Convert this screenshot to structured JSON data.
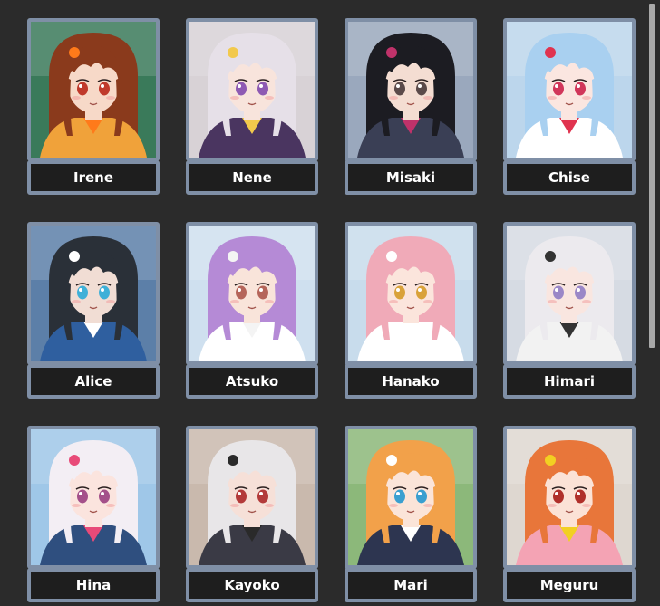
{
  "characters": [
    {
      "name": "Irene",
      "icon": "character-portrait-icon",
      "bg": "#3a7a5a",
      "hair": "#8a3a1c",
      "skin": "#f7d9c8",
      "eyes": "#c0392b",
      "outfit": "#f0a23a",
      "accent": "#ff7a1a"
    },
    {
      "name": "Nene",
      "icon": "character-portrait-icon",
      "bg": "#d8d2d6",
      "hair": "#e6e0e8",
      "skin": "#f8e4dc",
      "eyes": "#8e5ab3",
      "outfit": "#4a3560",
      "accent": "#f2c94c"
    },
    {
      "name": "Misaki",
      "icon": "character-portrait-icon",
      "bg": "#9aa8bd",
      "hair": "#1c1c22",
      "skin": "#f4ddd2",
      "eyes": "#5b4a4a",
      "outfit": "#3a3f55",
      "accent": "#c0326a"
    },
    {
      "name": "Chise",
      "icon": "character-portrait-icon",
      "bg": "#bcd6ec",
      "hair": "#a9d0f0",
      "skin": "#fbe6e0",
      "eyes": "#d1365a",
      "outfit": "#ffffff",
      "accent": "#e0334f"
    },
    {
      "name": "Alice",
      "icon": "character-portrait-icon",
      "bg": "#5c7fa8",
      "hair": "#2a3038",
      "skin": "#f1ddd4",
      "eyes": "#3fb0d8",
      "outfit": "#2f5f9f",
      "accent": "#ffffff"
    },
    {
      "name": "Atsuko",
      "icon": "character-portrait-icon",
      "bg": "#cfe0ef",
      "hair": "#b58ad6",
      "skin": "#f9e4da",
      "eyes": "#b5655a",
      "outfit": "#ffffff",
      "accent": "#f4f4f4"
    },
    {
      "name": "Hanako",
      "icon": "character-portrait-icon",
      "bg": "#c8dcec",
      "hair": "#f0aab8",
      "skin": "#fbe5dc",
      "eyes": "#d9a23a",
      "outfit": "#ffffff",
      "accent": "#ffffff"
    },
    {
      "name": "Himari",
      "icon": "character-portrait-icon",
      "bg": "#d6dbe3",
      "hair": "#eceaee",
      "skin": "#f9e6e0",
      "eyes": "#9a87c7",
      "outfit": "#f2f2f2",
      "accent": "#333333"
    },
    {
      "name": "Hina",
      "icon": "character-portrait-icon",
      "bg": "#9fc7e8",
      "hair": "#f3eef4",
      "skin": "#fbe4de",
      "eyes": "#a4508a",
      "outfit": "#2f4f7f",
      "accent": "#e84a78"
    },
    {
      "name": "Kayoko",
      "icon": "character-portrait-icon",
      "bg": "#c9b9ad",
      "hair": "#e8e6e8",
      "skin": "#f6e0d8",
      "eyes": "#b33a3a",
      "outfit": "#3a3a45",
      "accent": "#2a2a2a"
    },
    {
      "name": "Mari",
      "icon": "character-portrait-icon",
      "bg": "#8cb87a",
      "hair": "#f2a14a",
      "skin": "#fbe4d8",
      "eyes": "#3a9fd0",
      "outfit": "#2d3550",
      "accent": "#ffffff"
    },
    {
      "name": "Meguru",
      "icon": "character-portrait-icon",
      "bg": "#ded7d0",
      "hair": "#e8763a",
      "skin": "#fbe2d6",
      "eyes": "#b0302a",
      "outfit": "#f4a3b4",
      "accent": "#f2d022"
    }
  ]
}
